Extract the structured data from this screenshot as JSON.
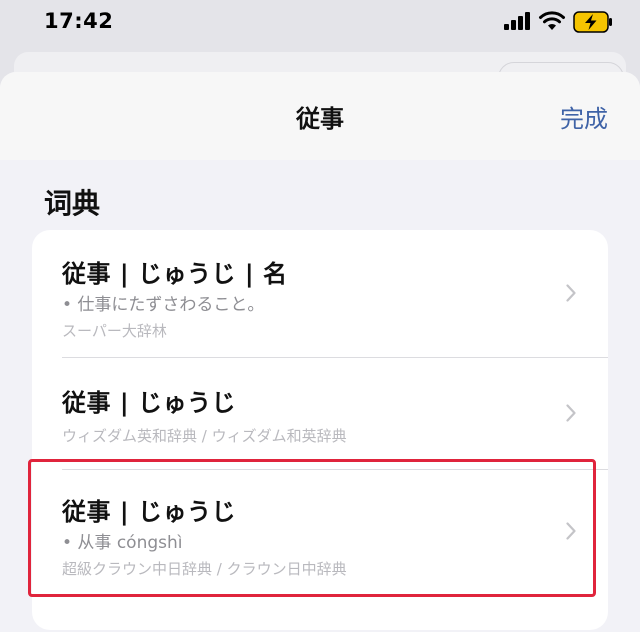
{
  "status_bar": {
    "time": "17:42"
  },
  "nav": {
    "title": "従事",
    "done_label": "完成"
  },
  "section": {
    "header": "词典"
  },
  "entries": [
    {
      "title": "従事 | じゅうじ | 名",
      "definition": "• 仕事にたずさわること。",
      "source": "スーパー大辞林"
    },
    {
      "title": "従事 | じゅうじ",
      "source": "ウィズダム英和辞典 / ウィズダム和英辞典"
    },
    {
      "title": "従事 | じゅうじ",
      "definition": "• 从事 cóngshì",
      "source": "超級クラウン中日辞典 / クラウン日中辞典"
    }
  ],
  "colors": {
    "accent": "#3f63a7",
    "highlight": "#e0243c",
    "battery": "#f5c400"
  },
  "icons": [
    "signal-icon",
    "wifi-icon",
    "battery-charging-icon",
    "chevron-right-icon"
  ]
}
